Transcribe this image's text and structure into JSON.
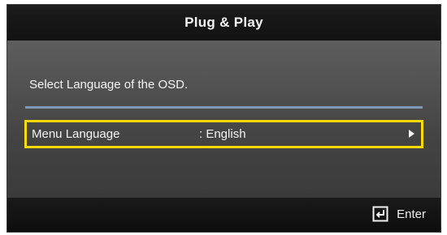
{
  "dialog": {
    "title": "Plug & Play",
    "prompt": "Select Language of the OSD."
  },
  "menu": {
    "label": "Menu Language",
    "value": ": English"
  },
  "footer": {
    "enter_label": "Enter"
  },
  "colors": {
    "highlight": "#ffd800",
    "divider": "#7f98b8"
  },
  "icons": {
    "row_arrow": "arrow-right-icon",
    "enter": "enter-icon"
  }
}
